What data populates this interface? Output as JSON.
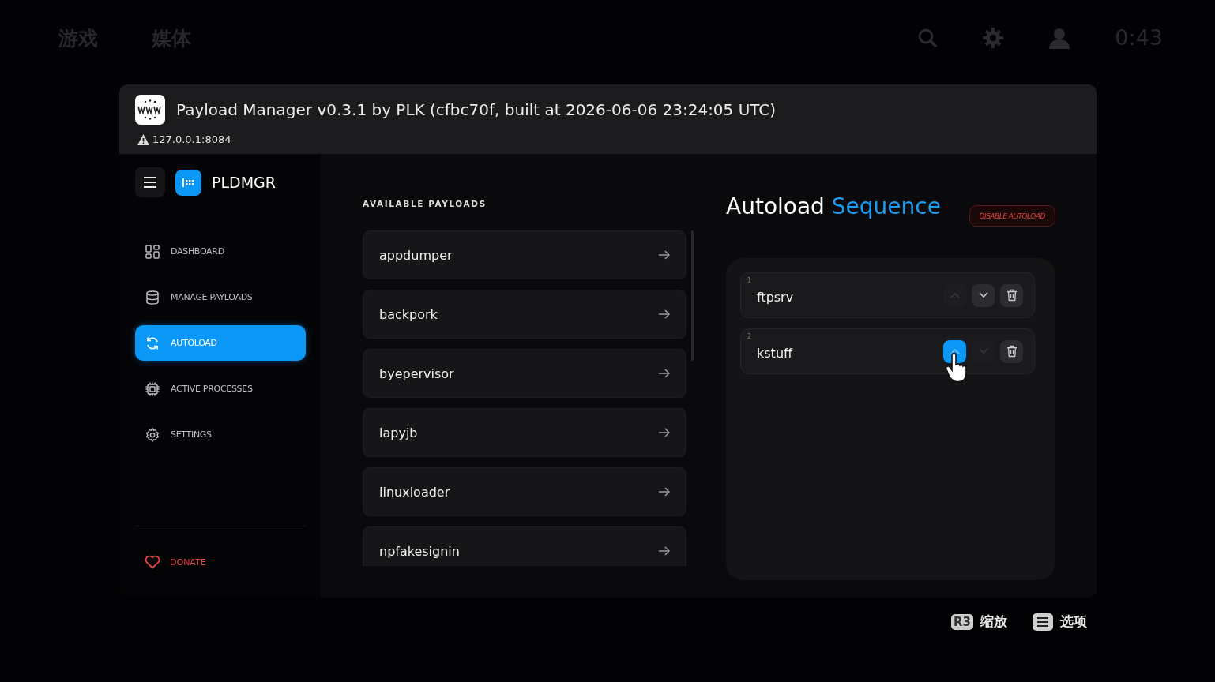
{
  "system_bar": {
    "tabs": [
      {
        "label": "游戏"
      },
      {
        "label": "媒体"
      }
    ],
    "time": "0:43"
  },
  "window": {
    "title": "Payload Manager v0.3.1 by PLK (cfbc70f, built at 2026-06-06 23:24:05 UTC)",
    "address": "127.0.0.1:8084"
  },
  "sidebar": {
    "brand": "PLDMGR",
    "items": [
      {
        "label": "DASHBOARD",
        "selected": false
      },
      {
        "label": "MANAGE PAYLOADS",
        "selected": false
      },
      {
        "label": "AUTOLOAD",
        "selected": true
      },
      {
        "label": "ACTIVE PROCESSES",
        "selected": false
      },
      {
        "label": "SETTINGS",
        "selected": false
      }
    ],
    "donate": "DONATE"
  },
  "payloads": {
    "heading": "AVAILABLE PAYLOADS",
    "items": [
      "appdumper",
      "backpork",
      "byepervisor",
      "lapyjb",
      "linuxloader",
      "npfakesignin"
    ]
  },
  "autoload": {
    "title": "Autoload **Sequence**",
    "disable_button": "DISABLE AUTOLOAD",
    "items": [
      {
        "index": "1",
        "name": "ftpsrv",
        "up_enabled": false,
        "up_focused": false,
        "down_enabled": true
      },
      {
        "index": "2",
        "name": "kstuff",
        "up_enabled": true,
        "up_focused": true,
        "down_enabled": false
      }
    ]
  },
  "hints": [
    {
      "kind": "keycap",
      "key": "R3",
      "label": "缩放"
    },
    {
      "kind": "options",
      "label": "选项"
    }
  ]
}
